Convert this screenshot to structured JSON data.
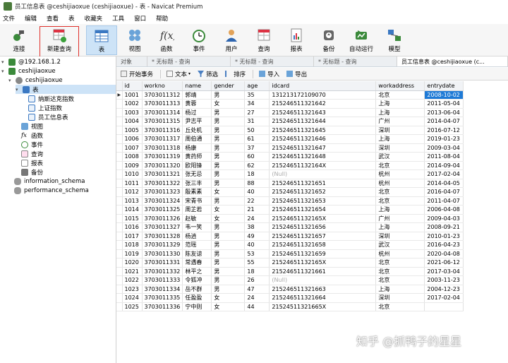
{
  "window": {
    "title": "员工信息表 @ceshijiaoxue (ceshijiaoxue) - 表 - Navicat Premium"
  },
  "menu": [
    "文件",
    "编辑",
    "查看",
    "表",
    "收藏夹",
    "工具",
    "窗口",
    "帮助"
  ],
  "toolbar": {
    "connect": "连接",
    "new_query": "新建查询",
    "table": "表",
    "view": "视图",
    "function": "函数",
    "event": "事件",
    "user": "用户",
    "query": "查询",
    "report": "报表",
    "backup": "备份",
    "automation": "自动运行",
    "model": "模型"
  },
  "tabs": {
    "objects": "对象",
    "query1": "* 无标题 - 查询",
    "query2": "* 无标题 - 查询",
    "query3": "* 无标题 - 查询",
    "active": "员工信息表 @ceshijiaoxue (c..."
  },
  "sidebar": {
    "connection": "@192.168.1.2",
    "database": "ceshijiaoxue",
    "schema": "ceshijiaoxue",
    "tables_group": "表",
    "tables": [
      "纳斯达克指数",
      "上证指数",
      "员工信息表"
    ],
    "views": "视图",
    "functions": "函数",
    "events": "事件",
    "queries": "查询",
    "reports": "报表",
    "backups": "备份",
    "other_dbs": [
      "information_schema",
      "performance_schema"
    ]
  },
  "grid_toolbar": {
    "begin_transaction": "开始事务",
    "text": "文本",
    "filter": "筛选",
    "sort": "排序",
    "import": "导入",
    "export": "导出"
  },
  "table": {
    "columns": [
      "id",
      "workno",
      "name",
      "gender",
      "age",
      "idcard",
      "workaddress",
      "entrydate"
    ],
    "rows": [
      [
        "1001",
        "3703011312",
        "郭靖",
        "男",
        "35",
        "131213172109070",
        "北京",
        "2008-10-02"
      ],
      [
        "1002",
        "3703011313",
        "黄蓉",
        "女",
        "34",
        "215246511321642",
        "上海",
        "2011-05-04"
      ],
      [
        "1003",
        "3703011314",
        "杨过",
        "男",
        "27",
        "215246511321643",
        "上海",
        "2013-06-04"
      ],
      [
        "1004",
        "3703011315",
        "尹志平",
        "男",
        "31",
        "215246511321644",
        "广州",
        "2014-04-07"
      ],
      [
        "1005",
        "3703011316",
        "丘处机",
        "男",
        "50",
        "215246511321645",
        "深圳",
        "2016-07-12"
      ],
      [
        "1006",
        "3703011317",
        "周伯通",
        "男",
        "61",
        "215246511321646",
        "上海",
        "2019-01-23"
      ],
      [
        "1007",
        "3703011318",
        "杨康",
        "男",
        "37",
        "215246511321647",
        "深圳",
        "2009-03-04"
      ],
      [
        "1008",
        "3703011319",
        "黄药师",
        "男",
        "60",
        "215246511321648",
        "武汉",
        "2011-08-04"
      ],
      [
        "1009",
        "3703011320",
        "欧阳锋",
        "男",
        "62",
        "21524651132164X",
        "北京",
        "2014-09-04"
      ],
      [
        "1010",
        "3703011321",
        "张无忌",
        "男",
        "18",
        "(Null)",
        "杭州",
        "2017-02-04"
      ],
      [
        "1011",
        "3703011322",
        "张三丰",
        "男",
        "88",
        "215246511321651",
        "杭州",
        "2014-04-05"
      ],
      [
        "1012",
        "3703011323",
        "殷素素",
        "女",
        "40",
        "215246511321652",
        "北京",
        "2016-04-07"
      ],
      [
        "1013",
        "3703011324",
        "宋青书",
        "男",
        "22",
        "215246511321653",
        "北京",
        "2011-04-07"
      ],
      [
        "1014",
        "3703011325",
        "周芷若",
        "女",
        "21",
        "215246511321654",
        "上海",
        "2006-04-08"
      ],
      [
        "1015",
        "3703011326",
        "赵敏",
        "女",
        "24",
        "21524651132165X",
        "广州",
        "2009-04-03"
      ],
      [
        "1016",
        "3703011327",
        "韦一笑",
        "男",
        "38",
        "215246511321656",
        "上海",
        "2008-09-21"
      ],
      [
        "1017",
        "3703011328",
        "杨逍",
        "男",
        "49",
        "215246511321657",
        "深圳",
        "2010-01-23"
      ],
      [
        "1018",
        "3703011329",
        "范瑶",
        "男",
        "40",
        "215246511321658",
        "武汉",
        "2016-04-23"
      ],
      [
        "1019",
        "3703011330",
        "陈友谅",
        "男",
        "53",
        "215246511321659",
        "杭州",
        "2020-04-08"
      ],
      [
        "1020",
        "3703011331",
        "常遇春",
        "男",
        "55",
        "21524651132165X",
        "北京",
        "2021-06-12"
      ],
      [
        "1021",
        "3703011332",
        "林平之",
        "男",
        "18",
        "215246511321661",
        "北京",
        "2017-03-04"
      ],
      [
        "1022",
        "3703011333",
        "令狐冲",
        "男",
        "26",
        "(Null)",
        "北京",
        "2003-11-23"
      ],
      [
        "1023",
        "3703011334",
        "岳不群",
        "男",
        "47",
        "215246511321663",
        "上海",
        "2004-12-23"
      ],
      [
        "1024",
        "3703011335",
        "任盈盈",
        "女",
        "24",
        "215246511321664",
        "深圳",
        "2017-02-04"
      ],
      [
        "1025",
        "3703011336",
        "宁中则",
        "女",
        "44",
        "21524511321665X",
        "北京",
        ""
      ]
    ]
  },
  "watermark": "知乎 @抓鸭子的星星",
  "colors": {
    "selection": "#1e7ad6",
    "highlight_box": "#e0302b",
    "active_tool": "#cde3f7"
  }
}
